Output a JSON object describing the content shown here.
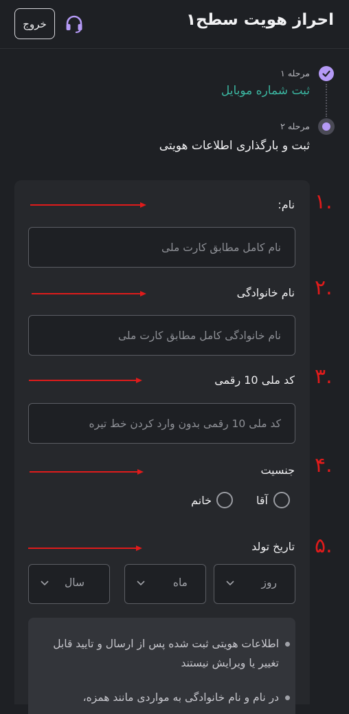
{
  "header": {
    "title": "احراز هویت سطح۱",
    "exit_label": "خروج",
    "support_icon": "headset-icon",
    "accent": "#b59af6"
  },
  "stepper": {
    "steps": [
      {
        "number_label": "مرحله ۱",
        "title": "ثبت شماره موبایل",
        "status": "completed",
        "color": "#3bb5a0"
      },
      {
        "number_label": "مرحله ۲",
        "title": "ثبت و بارگذاری اطلاعات هویتی",
        "status": "current"
      }
    ]
  },
  "form": {
    "name": {
      "label": "نام:",
      "placeholder": "نام کامل مطابق کارت ملی",
      "value": ""
    },
    "family": {
      "label": "نام خانوادگی",
      "placeholder": "نام خانوادگی کامل مطابق کارت ملی",
      "value": ""
    },
    "national_code": {
      "label": "کد ملی 10 رقمی",
      "placeholder": "کد ملی 10 رقمی بدون وارد کردن خط تیره",
      "value": ""
    },
    "gender": {
      "label": "جنسیت",
      "options": [
        "آقا",
        "خانم"
      ],
      "selected": null
    },
    "birth_date": {
      "label": "تاریخ تولد",
      "day": "روز",
      "month": "ماه",
      "year": "سال"
    }
  },
  "annotations": {
    "color": "#e01b1b",
    "numbers": [
      "۱.",
      "۲.",
      "۳.",
      "۴.",
      "۵."
    ]
  },
  "notice": {
    "items": [
      "اطلاعات هویتی ثبت شده پس از ارسال و تایید قابل تغییر یا ویرایش نیستند",
      "در نام و نام خانوادگی به مواردی مانند همزه،"
    ]
  }
}
